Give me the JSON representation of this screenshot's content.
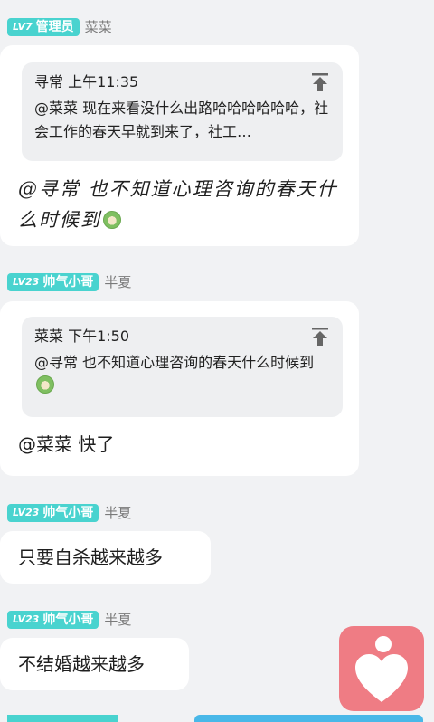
{
  "messages": [
    {
      "level": "LV7",
      "role": "管理员",
      "author": "菜菜",
      "quote": {
        "author": "寻常",
        "time": "上午11:35",
        "text": "@菜菜 现在来看没什么出路哈哈哈哈哈哈，社会工作的春天早就到来了，社工…"
      },
      "reply": "@寻常 也不知道心理咨询的春天什么时候到"
    },
    {
      "level": "LV23",
      "role": "帅气小哥",
      "author": "半夏",
      "quote": {
        "author": "菜菜",
        "time": "下午1:50",
        "text": "@寻常 也不知道心理咨询的春天什么时候到"
      },
      "reply": "@菜菜 快了"
    },
    {
      "level": "LV23",
      "role": "帅气小哥",
      "author": "半夏",
      "reply": "只要自杀越来越多"
    },
    {
      "level": "LV23",
      "role": "帅气小哥",
      "author": "半夏",
      "reply": "不结婚越来越多"
    }
  ],
  "icons": {
    "pin": "pin-to-top-icon",
    "emoji": "cabbage-emoji-icon",
    "fab": "heart-person-icon"
  },
  "colors": {
    "badge": "#49d3cf",
    "background": "#f1f2f4",
    "fab": "#ef7c84"
  }
}
